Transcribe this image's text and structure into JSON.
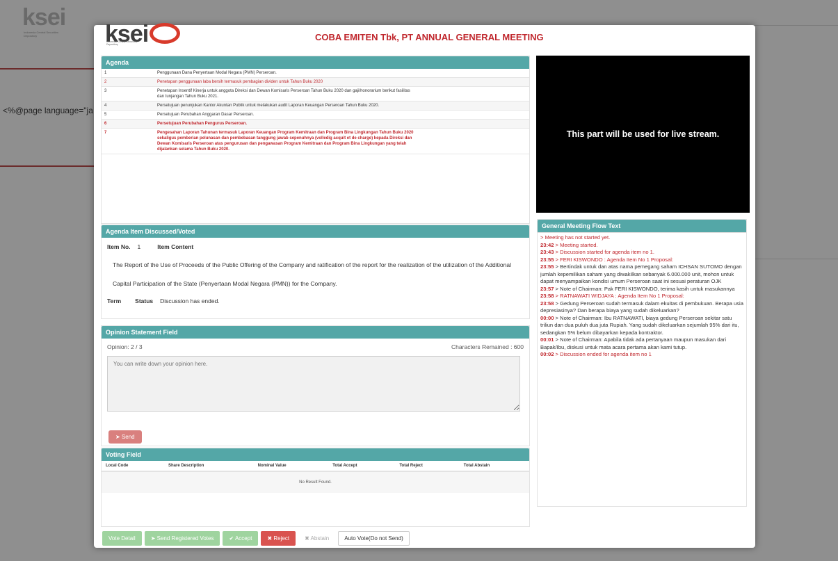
{
  "background": {
    "logo": "ksei",
    "logo_sub": "Indonesia Central Securities Depository",
    "code_text": "<%@page language=\"ja"
  },
  "modal": {
    "logo": "ksei",
    "logo_sub": "Indonesia Central Securities Depository",
    "title": "COBA EMITEN Tbk, PT ANNUAL GENERAL MEETING"
  },
  "agenda": {
    "header": "Agenda",
    "rows": [
      {
        "no": "1",
        "text": "Penggunaan Dana Penyertaan Modal Negara (PMN) Perseroan.",
        "style": "normal"
      },
      {
        "no": "2",
        "text": "Penetapan penggunaan laba bersih termasuk pembagian dividen untuk Tahun Buku 2020",
        "style": "red"
      },
      {
        "no": "3",
        "text": "Penetapan Insentif Kinerja untuk anggota Direksi dan Dewan Komisaris Perseroan Tahun Buku 2020 dan gaji/honorarium berikut fasilitas dan tunjangan Tahun Buku 2021.",
        "style": "normal"
      },
      {
        "no": "4",
        "text": "Persetujuan penunjukan Kantor Akuntan Publik untuk melakukan audit Laporan Keuangan Perseroan Tahun Buku 2020.",
        "style": "normal"
      },
      {
        "no": "5",
        "text": "Persetujuan Perubahan Anggaran Dasar Perseroan.",
        "style": "normal"
      },
      {
        "no": "6",
        "text": "Persetujuan Perubahan Pengurus Perseroan.",
        "style": "redbold"
      },
      {
        "no": "7",
        "text": "Pengesahan Laporan Tahunan termasuk Laporan Keuangan Program Kemitraan dan Program Bina Lingkungan Tahun Buku 2020 sekaligus pemberian pelunasan dan pembebasan tanggung jawab sepenuhnya (volledig acquit et de charge) kepada Direksi dan Dewan Komisaris Perseroan atas pengurusan dan pengawasan Program Kemitraan dan Program Bina Lingkungan yang telah dijalankan selama Tahun Buku 2020.",
        "style": "redbold"
      }
    ]
  },
  "stream": {
    "text": "This part will be used for live stream."
  },
  "discussed": {
    "header": "Agenda Item Discussed/Voted",
    "item_no_label": "Item No.",
    "item_no_value": "1",
    "item_content_label": "Item Content",
    "content": "The Report of the Use of Proceeds of the Public Offering of the Company and ratification of the report for the realization of the utilization of the Additional Capital Participation of the State (Penyertaan Modal Negara (PMN)) for the Company.",
    "term_label": "Term",
    "status_label": "Status",
    "status_value": "Discussion has ended."
  },
  "opinion": {
    "header": "Opinion Statement Field",
    "count": "Opinion: 2 / 3",
    "chars": "Characters Remained : 600",
    "placeholder": "You can write down your opinion here.",
    "send_label": "Send"
  },
  "voting": {
    "header": "Voting Field",
    "columns": [
      "Local Code",
      "Share Description",
      "Nominal Value",
      "Total Accept",
      "Total Reject",
      "Total Abstain"
    ],
    "empty": "No Result Found."
  },
  "buttons": {
    "vote_detail": "Vote Detail",
    "send_registered": "Send Registered Votes",
    "accept": "Accept",
    "reject": "Reject",
    "abstain": "Abstain",
    "auto_vote": "Auto Vote(Do not Send)"
  },
  "flow": {
    "header": "General Meeting Flow Text",
    "lines": [
      {
        "time": "",
        "text": "> Meeting has not started yet.",
        "color": "red"
      },
      {
        "time": "23:42",
        "text": " > Meeting started.",
        "color": "red"
      },
      {
        "time": "23:43",
        "text": " > Discussion started for agenda item no 1.",
        "color": "red"
      },
      {
        "time": "23:55",
        "text": " > FERI KISWONDO : Agenda Item No 1 Proposal:",
        "color": "red"
      },
      {
        "time": "23:55",
        "text": " > Bertindak untuk dan atas nama pemegang saham ICHSAN SUTOMO dengan jumlah kepemilikan saham yang diwakilkan sebanyak 6.000.000 unit, mohon untuk dapat menyampaikan kondisi umum Perseroan saat ini sesuai peraturan OJK",
        "color": "black"
      },
      {
        "time": "23:57",
        "text": " > Note of Chairman: Pak FERI KISWONDO, terima kasih untuk masukannya",
        "color": "black"
      },
      {
        "time": "23:58",
        "text": " > RATNAWATI WIDJAYA : Agenda Item No 1 Proposal:",
        "color": "red"
      },
      {
        "time": "23:58",
        "text": " > Gedung Perseroan sudah termasuk dalam ekuitas di pembukuan. Berapa usia depresiasinya? Dan berapa biaya yang sudah dikeluarkan?",
        "color": "black"
      },
      {
        "time": "00:00",
        "text": " > Note of Chairman: Ibu RATNAWATI, biaya gedung Perseroan sekitar satu triliun dan dua puluh dua juta Rupiah. Yang sudah dikeluarkan sejumlah 95% dari itu, sedangkan 5% belum dibayarkan kepada kontraktor.",
        "color": "black"
      },
      {
        "time": "00:01",
        "text": " > Note of Chairman: Apabila tidak ada pertanyaan maupun masukan dari Bapak/Ibu, diskusi untuk mata acara pertama akan kami tutup.",
        "color": "black"
      },
      {
        "time": "00:02",
        "text": " > Discussion ended for agenda item no 1",
        "color": "red"
      }
    ]
  }
}
